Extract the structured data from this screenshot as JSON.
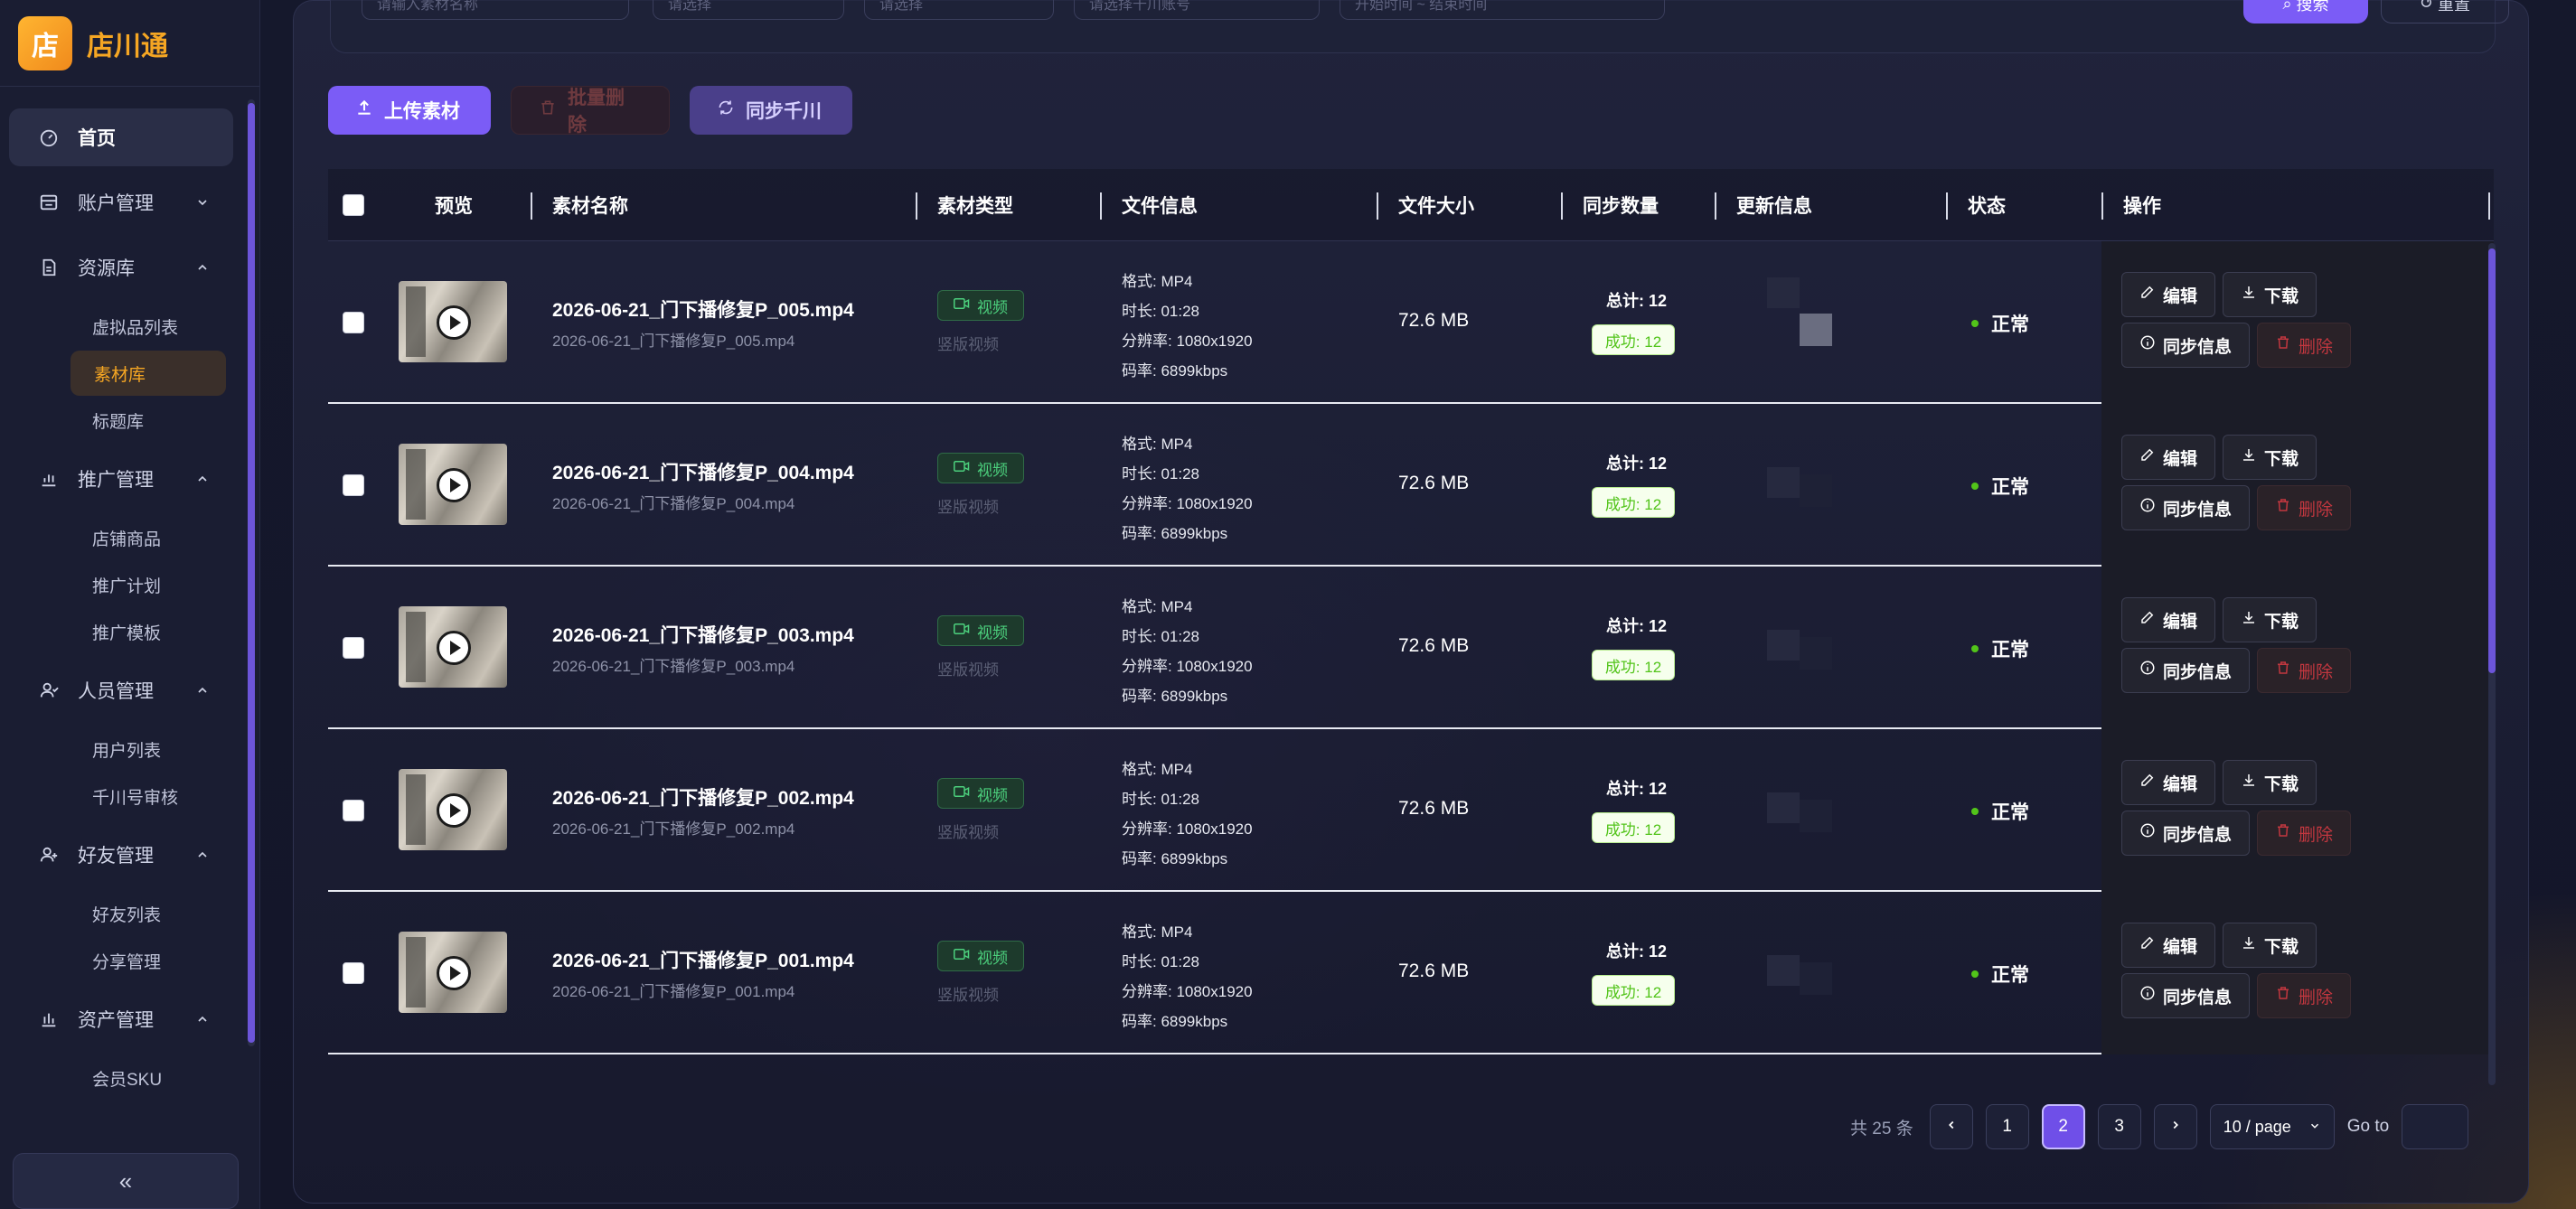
{
  "app": {
    "logo_char": "店",
    "title": "店川通"
  },
  "sidebar": {
    "items": [
      {
        "label": "首页",
        "icon": "dashboard-icon",
        "active": true
      },
      {
        "label": "账户管理",
        "icon": "account-icon",
        "chevron": "down"
      },
      {
        "label": "资源库",
        "icon": "document-icon",
        "chevron": "up",
        "children": [
          {
            "label": "虚拟品列表"
          },
          {
            "label": "素材库",
            "active": true
          },
          {
            "label": "标题库"
          }
        ]
      },
      {
        "label": "推广管理",
        "icon": "chart-icon",
        "chevron": "up",
        "children": [
          {
            "label": "店铺商品"
          },
          {
            "label": "推广计划"
          },
          {
            "label": "推广模板"
          }
        ]
      },
      {
        "label": "人员管理",
        "icon": "users-icon",
        "chevron": "up",
        "children": [
          {
            "label": "用户列表"
          },
          {
            "label": "千川号审核"
          }
        ]
      },
      {
        "label": "好友管理",
        "icon": "friends-icon",
        "chevron": "up",
        "children": [
          {
            "label": "好友列表"
          },
          {
            "label": "分享管理"
          }
        ]
      },
      {
        "label": "资产管理",
        "icon": "asset-icon",
        "chevron": "up",
        "children": [
          {
            "label": "会员SKU"
          }
        ]
      }
    ],
    "collapse_label": "«"
  },
  "filters": {
    "fields": [
      "请输入素材名称",
      "请选择",
      "请选择",
      "请选择千川账号",
      "开始时间 ~ 结束时间"
    ],
    "search_label": "搜索",
    "reset_label": "重置"
  },
  "toolbar": {
    "upload_label": "上传素材",
    "batch_delete_label": "批量删除",
    "sync_label": "同步千川"
  },
  "table": {
    "headers": {
      "preview": "预览",
      "name": "素材名称",
      "type": "素材类型",
      "file_info": "文件信息",
      "size": "文件大小",
      "sync_count": "同步数量",
      "update_info": "更新信息",
      "status": "状态",
      "ops": "操作"
    },
    "rows": [
      {
        "name": "2026-06-21_门下播修复P_005.mp4",
        "sub": "2026-06-21_门下播修复P_005.mp4",
        "type": "视频",
        "type_sub": "竖版视频",
        "format": "格式: MP4",
        "duration": "时长: 01:28",
        "resolution": "分辨率: 1080x1920",
        "bitrate": "码率: 6899kbps",
        "size": "72.6 MB",
        "sync_total": "总计: 12",
        "sync_ok": "成功: 12",
        "status": "正常"
      },
      {
        "name": "2026-06-21_门下播修复P_004.mp4",
        "sub": "2026-06-21_门下播修复P_004.mp4",
        "type": "视频",
        "type_sub": "竖版视频",
        "format": "格式: MP4",
        "duration": "时长: 01:28",
        "resolution": "分辨率: 1080x1920",
        "bitrate": "码率: 6899kbps",
        "size": "72.6 MB",
        "sync_total": "总计: 12",
        "sync_ok": "成功: 12",
        "status": "正常"
      },
      {
        "name": "2026-06-21_门下播修复P_003.mp4",
        "sub": "2026-06-21_门下播修复P_003.mp4",
        "type": "视频",
        "type_sub": "竖版视频",
        "format": "格式: MP4",
        "duration": "时长: 01:28",
        "resolution": "分辨率: 1080x1920",
        "bitrate": "码率: 6899kbps",
        "size": "72.6 MB",
        "sync_total": "总计: 12",
        "sync_ok": "成功: 12",
        "status": "正常"
      },
      {
        "name": "2026-06-21_门下播修复P_002.mp4",
        "sub": "2026-06-21_门下播修复P_002.mp4",
        "type": "视频",
        "type_sub": "竖版视频",
        "format": "格式: MP4",
        "duration": "时长: 01:28",
        "resolution": "分辨率: 1080x1920",
        "bitrate": "码率: 6899kbps",
        "size": "72.6 MB",
        "sync_total": "总计: 12",
        "sync_ok": "成功: 12",
        "status": "正常"
      },
      {
        "name": "2026-06-21_门下播修复P_001.mp4",
        "sub": "2026-06-21_门下播修复P_001.mp4",
        "type": "视频",
        "type_sub": "竖版视频",
        "format": "格式: MP4",
        "duration": "时长: 01:28",
        "resolution": "分辨率: 1080x1920",
        "bitrate": "码率: 6899kbps",
        "size": "72.6 MB",
        "sync_total": "总计: 12",
        "sync_ok": "成功: 12",
        "status": "正常"
      }
    ],
    "row_actions": {
      "edit": "编辑",
      "download": "下载",
      "sync_info": "同步信息",
      "delete": "删除"
    }
  },
  "pagination": {
    "total": "共 25 条",
    "pages": [
      "1",
      "2",
      "3"
    ],
    "current": "2",
    "page_size": "10 / page",
    "goto_label": "Go to"
  },
  "colors": {
    "accent": "#7b5cf6",
    "brand": "#f5a623",
    "success": "#52c41a",
    "danger": "#c2373f"
  }
}
